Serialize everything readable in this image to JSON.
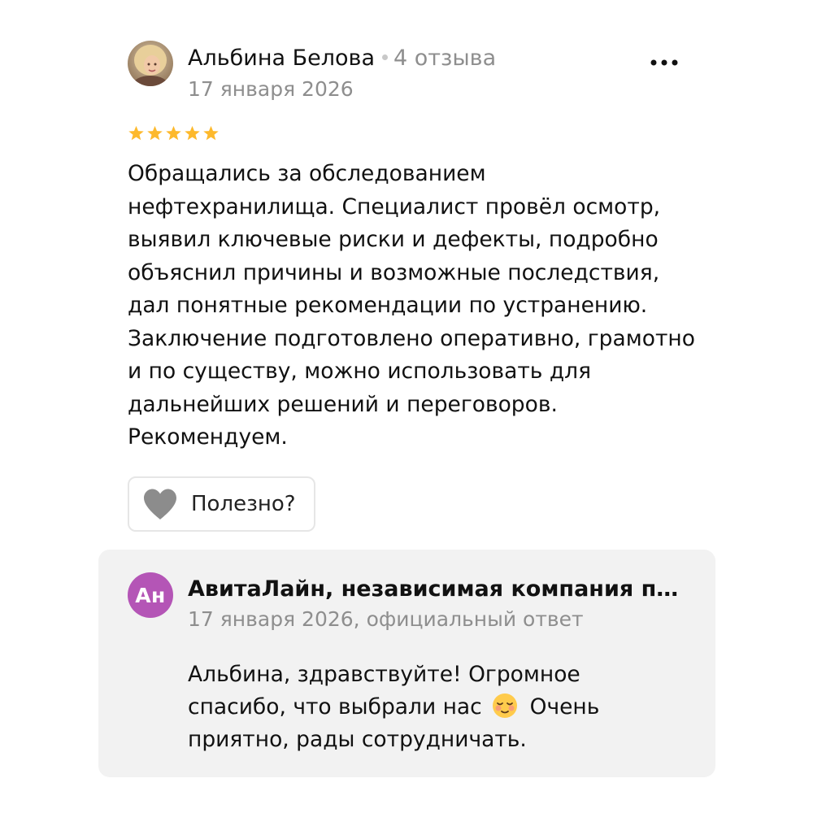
{
  "review": {
    "author_name": "Альбина Белова",
    "author_reviews_count": "4 отзыва",
    "date": "17 января 2026",
    "rating": 5,
    "rating_color": "#fdb92c",
    "text": "Обращались за обследованием нефтехранилища. Специалист провёл осмотр, выявил ключевые риски и дефекты, подробно объяснил причины и возможные последствия, дал понятные рекомендации по устранению. Заключение подготовлено оперативно, грамотно и по существу, можно использовать для дальнейших решений и переговоров. Рекомендуем.",
    "helpful_label": "Полезно?",
    "more_icon": "more-horizontal-icon"
  },
  "reply": {
    "avatar_initials": "Ан",
    "avatar_color": "#b455b6",
    "company_name": "АвитаЛайн, независимая компания по…",
    "meta": "17 января 2026, официальный ответ",
    "text_before_emoji": "Альбина, здравствуйте! Огромное спасибо, что выбрали нас",
    "emoji": "relieved-face-emoji",
    "text_after_emoji": "Очень приятно, рады сотрудничать.",
    "background": "#f2f2f2"
  }
}
